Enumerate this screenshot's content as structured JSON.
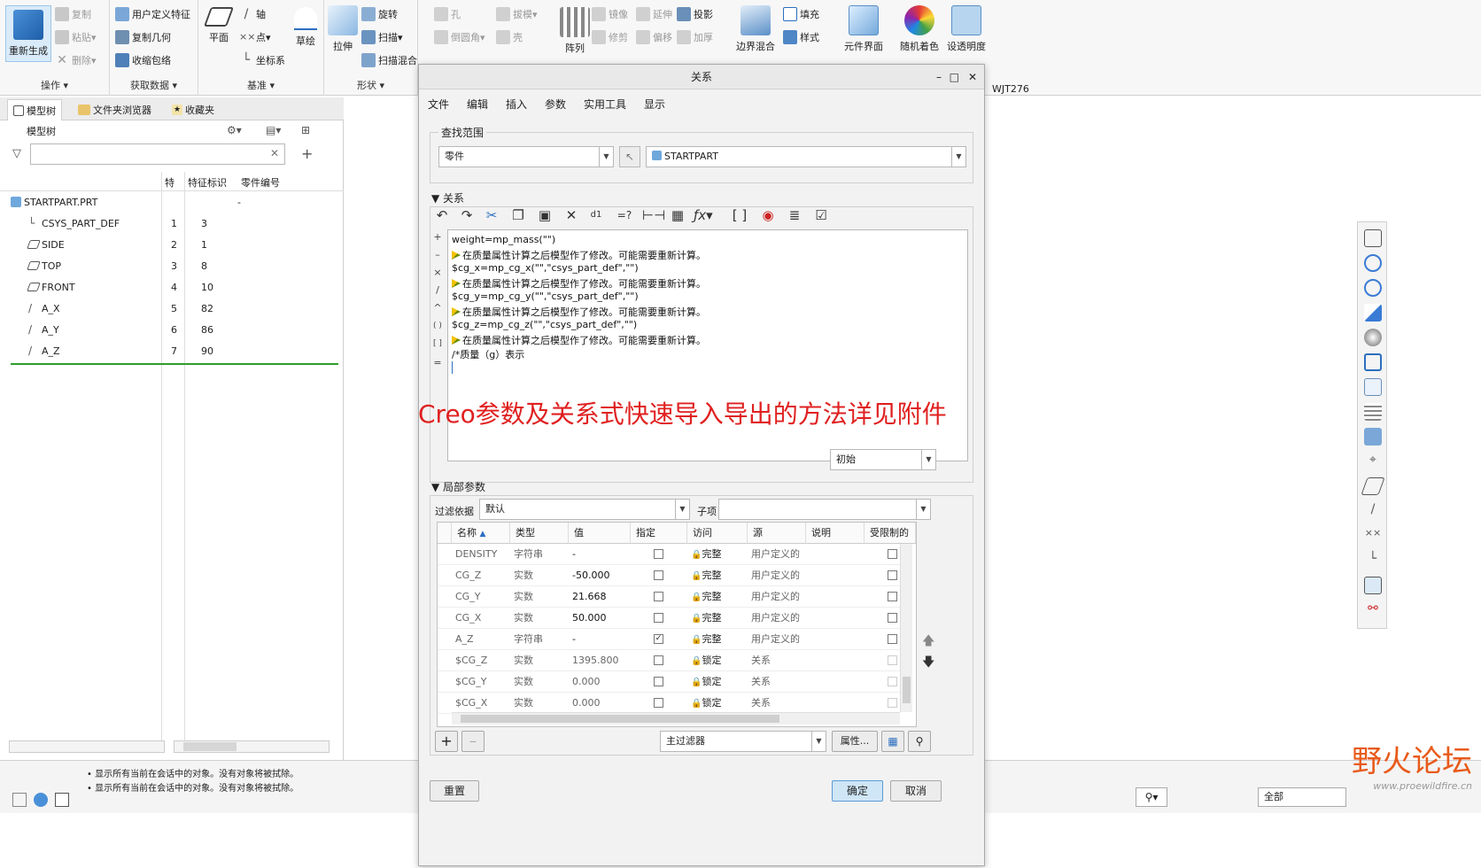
{
  "ribbon": {
    "groups": [
      {
        "label": "操作",
        "items": [
          "重新生成",
          "复制",
          "粘贴",
          "删除"
        ]
      },
      {
        "label": "获取数据",
        "items": [
          "用户定义特征",
          "复制几何",
          "收缩包络"
        ]
      },
      {
        "label": "基准",
        "items": [
          "平面",
          "轴",
          "点",
          "坐标系",
          "草绘"
        ]
      },
      {
        "label": "形状",
        "items": [
          "拉伸",
          "旋转",
          "扫描",
          "扫描混合"
        ]
      },
      {
        "label": "",
        "items": [
          "孔",
          "倒圆角",
          "拔模",
          "壳",
          "阵列",
          "镜像",
          "修剪",
          "延伸",
          "偏移",
          "投影",
          "加厚",
          "边界混合",
          "填充",
          "样式",
          "元件界面",
          "随机着色",
          "设透明度"
        ]
      }
    ],
    "user_label": "WJT276"
  },
  "left_panel": {
    "tabs": [
      "模型树",
      "文件夹浏览器",
      "收藏夹"
    ],
    "model_tree_label": "模型树",
    "search_placeholder": "",
    "columns": [
      "特",
      "特征标识",
      "零件编号"
    ],
    "root": {
      "name": "STARTPART.PRT",
      "c1": "",
      "c2": "-"
    },
    "rows": [
      {
        "name": "CSYS_PART_DEF",
        "c1": "1",
        "c2": "3"
      },
      {
        "name": "SIDE",
        "c1": "2",
        "c2": "1"
      },
      {
        "name": "TOP",
        "c1": "3",
        "c2": "8"
      },
      {
        "name": "FRONT",
        "c1": "4",
        "c2": "10"
      },
      {
        "name": "A_X",
        "c1": "5",
        "c2": "82"
      },
      {
        "name": "A_Y",
        "c1": "6",
        "c2": "86"
      },
      {
        "name": "A_Z",
        "c1": "7",
        "c2": "90"
      }
    ]
  },
  "dialog": {
    "title": "关系",
    "menu": [
      "文件",
      "编辑",
      "插入",
      "参数",
      "实用工具",
      "显示"
    ],
    "scope_label": "查找范围",
    "scope_type": "零件",
    "scope_model": "STARTPART",
    "relations_label": "关系",
    "gutter": [
      "+",
      "–",
      "×",
      "/",
      "^",
      "( )",
      "[ ]",
      "="
    ],
    "lines": [
      {
        "text": "weight=mp_mass(\"\")",
        "warn": false
      },
      {
        "text": "在质量属性计算之后模型作了修改。可能需要重新计算。",
        "warn": true
      },
      {
        "text": "$cg_x=mp_cg_x(\"\",\"csys_part_def\",\"\")",
        "warn": false
      },
      {
        "text": "在质量属性计算之后模型作了修改。可能需要重新计算。",
        "warn": true
      },
      {
        "text": "$cg_y=mp_cg_y(\"\",\"csys_part_def\",\"\")",
        "warn": false
      },
      {
        "text": "在质量属性计算之后模型作了修改。可能需要重新计算。",
        "warn": true
      },
      {
        "text": "$cg_z=mp_cg_z(\"\",\"csys_part_def\",\"\")",
        "warn": false
      },
      {
        "text": "在质量属性计算之后模型作了修改。可能需要重新计算。",
        "warn": true
      },
      {
        "text": "/*质量（g）表示",
        "warn": false
      }
    ],
    "units_combo": "初始",
    "local_params_label": "局部参数",
    "filter_label": "过滤依据",
    "filter_value": "默认",
    "sub_label": "子项",
    "sub_value": "",
    "table_columns": [
      "名称",
      "类型",
      "值",
      "指定",
      "访问",
      "源",
      "说明",
      "受限制的"
    ],
    "table_rows": [
      {
        "name": "DENSITY",
        "type": "字符串",
        "value": "-",
        "designated": false,
        "access": "完整",
        "source": "用户定义的",
        "restricted": false
      },
      {
        "name": "CG_Z",
        "type": "实数",
        "value": "-50.000",
        "designated": false,
        "access": "完整",
        "source": "用户定义的",
        "restricted": false
      },
      {
        "name": "CG_Y",
        "type": "实数",
        "value": "21.668",
        "designated": false,
        "access": "完整",
        "source": "用户定义的",
        "restricted": false
      },
      {
        "name": "CG_X",
        "type": "实数",
        "value": "50.000",
        "designated": false,
        "access": "完整",
        "source": "用户定义的",
        "restricted": false
      },
      {
        "name": "A_Z",
        "type": "字符串",
        "value": "-",
        "designated": true,
        "access": "完整",
        "source": "用户定义的",
        "restricted": false
      },
      {
        "name": "$CG_Z",
        "type": "实数",
        "value": "1395.800",
        "designated": false,
        "access": "锁定",
        "source": "关系",
        "restricted": false
      },
      {
        "name": "$CG_Y",
        "type": "实数",
        "value": "0.000",
        "designated": false,
        "access": "锁定",
        "source": "关系",
        "restricted": false
      },
      {
        "name": "$CG_X",
        "type": "实数",
        "value": "0.000",
        "designated": false,
        "access": "锁定",
        "source": "关系",
        "restricted": false
      }
    ],
    "main_filter": "主过滤器",
    "properties_btn": "属性...",
    "reset_btn": "重置",
    "ok_btn": "确定",
    "cancel_btn": "取消"
  },
  "status": {
    "messages": [
      "显示所有当前在会话中的对象。没有对象将被拭除。",
      "显示所有当前在会话中的对象。没有对象将被拭除。"
    ],
    "filter": "全部"
  },
  "overlay_text": "Creo参数及关系式快速导入导出的方法详见附件",
  "watermark": {
    "title": "野火论坛",
    "url": "www.proewildfire.cn"
  }
}
